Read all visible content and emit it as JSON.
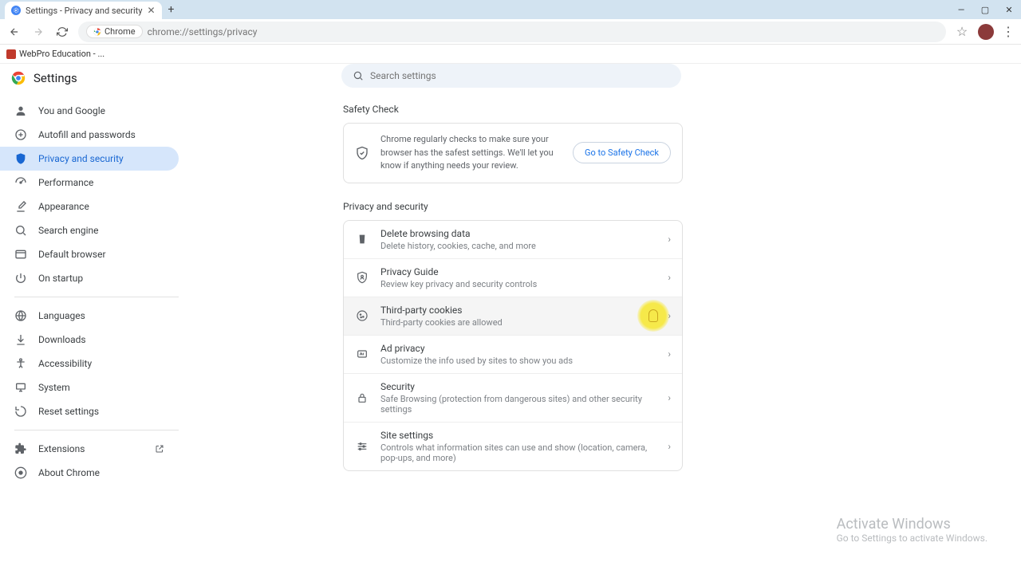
{
  "window": {
    "tab_title": "Settings - Privacy and security"
  },
  "toolbar": {
    "chip_label": "Chrome",
    "url": "chrome://settings/privacy"
  },
  "bookmarks": {
    "item1": "WebPro Education - ..."
  },
  "header": {
    "title": "Settings",
    "search_placeholder": "Search settings"
  },
  "sidebar": {
    "items": [
      {
        "label": "You and Google"
      },
      {
        "label": "Autofill and passwords"
      },
      {
        "label": "Privacy and security"
      },
      {
        "label": "Performance"
      },
      {
        "label": "Appearance"
      },
      {
        "label": "Search engine"
      },
      {
        "label": "Default browser"
      },
      {
        "label": "On startup"
      }
    ],
    "items2": [
      {
        "label": "Languages"
      },
      {
        "label": "Downloads"
      },
      {
        "label": "Accessibility"
      },
      {
        "label": "System"
      },
      {
        "label": "Reset settings"
      }
    ],
    "items3": [
      {
        "label": "Extensions"
      },
      {
        "label": "About Chrome"
      }
    ]
  },
  "safety": {
    "heading": "Safety Check",
    "desc": "Chrome regularly checks to make sure your browser has the safest settings. We'll let you know if anything needs your review.",
    "button": "Go to Safety Check"
  },
  "privacy": {
    "heading": "Privacy and security",
    "rows": [
      {
        "title": "Delete browsing data",
        "sub": "Delete history, cookies, cache, and more"
      },
      {
        "title": "Privacy Guide",
        "sub": "Review key privacy and security controls"
      },
      {
        "title": "Third-party cookies",
        "sub": "Third-party cookies are allowed"
      },
      {
        "title": "Ad privacy",
        "sub": "Customize the info used by sites to show you ads"
      },
      {
        "title": "Security",
        "sub": "Safe Browsing (protection from dangerous sites) and other security settings"
      },
      {
        "title": "Site settings",
        "sub": "Controls what information sites can use and show (location, camera, pop-ups, and more)"
      }
    ]
  },
  "watermark": {
    "line1": "Activate Windows",
    "line2": "Go to Settings to activate Windows."
  }
}
